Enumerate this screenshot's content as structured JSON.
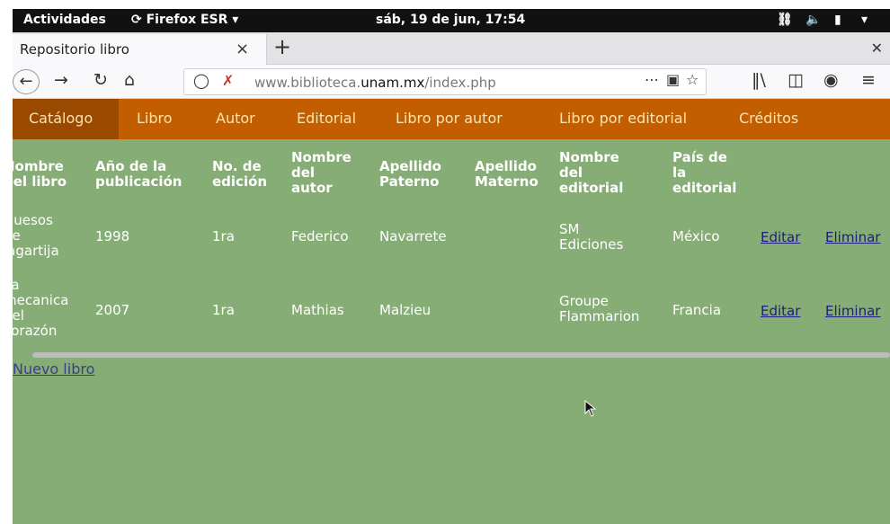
{
  "system_bar": {
    "activities": "Actividades",
    "app": "Firefox ESR",
    "datetime": "sáb, 19 de jun, 17:54"
  },
  "browser": {
    "tab_title": "Repositorio libro",
    "url_host": "www.biblioteca.",
    "url_domain": "unam.mx",
    "url_path": "/index.php"
  },
  "menu": {
    "items": [
      "Catálogo",
      "Libro",
      "Autor",
      "Editorial",
      "Libro por autor",
      "Libro por editorial",
      "Créditos"
    ]
  },
  "table": {
    "headers": [
      [
        "Nombre",
        "del libro"
      ],
      [
        "Año de la",
        "publicación"
      ],
      [
        "No. de",
        "edición"
      ],
      [
        "Nombre",
        "del",
        "autor"
      ],
      [
        "Apellido",
        "Paterno"
      ],
      [
        "Apellido",
        "Materno"
      ],
      [
        "Nombre",
        "del",
        "editorial"
      ],
      [
        "País de",
        "la",
        "editorial"
      ]
    ],
    "rows": [
      {
        "name": [
          "Huesos",
          "de",
          "lagartija"
        ],
        "year": "1998",
        "edition": "1ra",
        "author": "Federico",
        "paterno": "Navarrete",
        "materno": "",
        "editorial": [
          "SM",
          "Ediciones"
        ],
        "country": "México",
        "edit": "Editar",
        "delete": "Eliminar"
      },
      {
        "name": [
          "La",
          "mecanica",
          "del",
          "corazón"
        ],
        "year": "2007",
        "edition": "1ra",
        "author": "Mathias",
        "paterno": "Malzieu",
        "materno": "",
        "editorial": [
          "Groupe",
          "Flammarion"
        ],
        "country": "Francia",
        "edit": "Editar",
        "delete": "Eliminar"
      }
    ]
  },
  "new_book_link": "Nuevo libro",
  "colors": {
    "menu_bg": "#c25e00",
    "menu_active": "#9a4a00",
    "content_bg": "#86ad75",
    "link": "#1d1d7a"
  }
}
